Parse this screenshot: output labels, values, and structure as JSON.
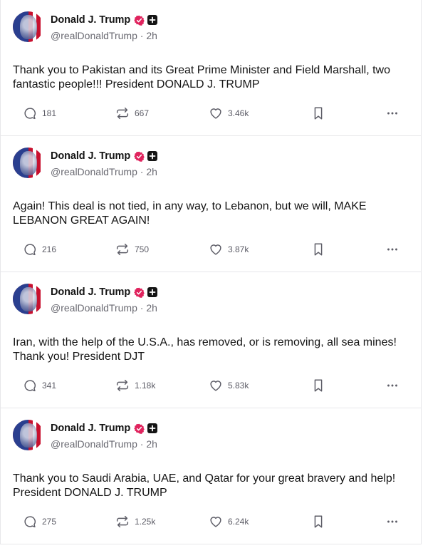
{
  "author": {
    "display_name": "Donald J. Trump",
    "handle": "@realDonaldTrump",
    "verified_color": "#e0245e"
  },
  "posts": [
    {
      "time": "2h",
      "text": "Thank you to Pakistan and its Great Prime Minister and Field Marshall, two fantastic people!!! President DONALD J. TRUMP",
      "replies": "181",
      "retruths": "667",
      "likes": "3.46k"
    },
    {
      "time": "2h",
      "text": "Again! This deal is not tied, in any way, to Lebanon, but we will, MAKE LEBANON GREAT AGAIN!",
      "replies": "216",
      "retruths": "750",
      "likes": "3.87k"
    },
    {
      "time": "2h",
      "text": "Iran, with the help of the U.S.A., has removed, or is removing, all sea mines! Thank you! President DJT",
      "replies": "341",
      "retruths": "1.18k",
      "likes": "5.83k"
    },
    {
      "time": "2h",
      "text": "Thank you to Saudi Arabia, UAE, and Qatar for your great bravery and help! President DONALD J. TRUMP",
      "replies": "275",
      "retruths": "1.25k",
      "likes": "6.24k"
    }
  ],
  "icons": {
    "reply": "reply-icon",
    "retruth": "retruth-icon",
    "like": "heart-icon",
    "bookmark": "bookmark-icon",
    "more": "more-icon",
    "verified": "verified-badge-icon",
    "plus": "plus-badge-icon"
  }
}
